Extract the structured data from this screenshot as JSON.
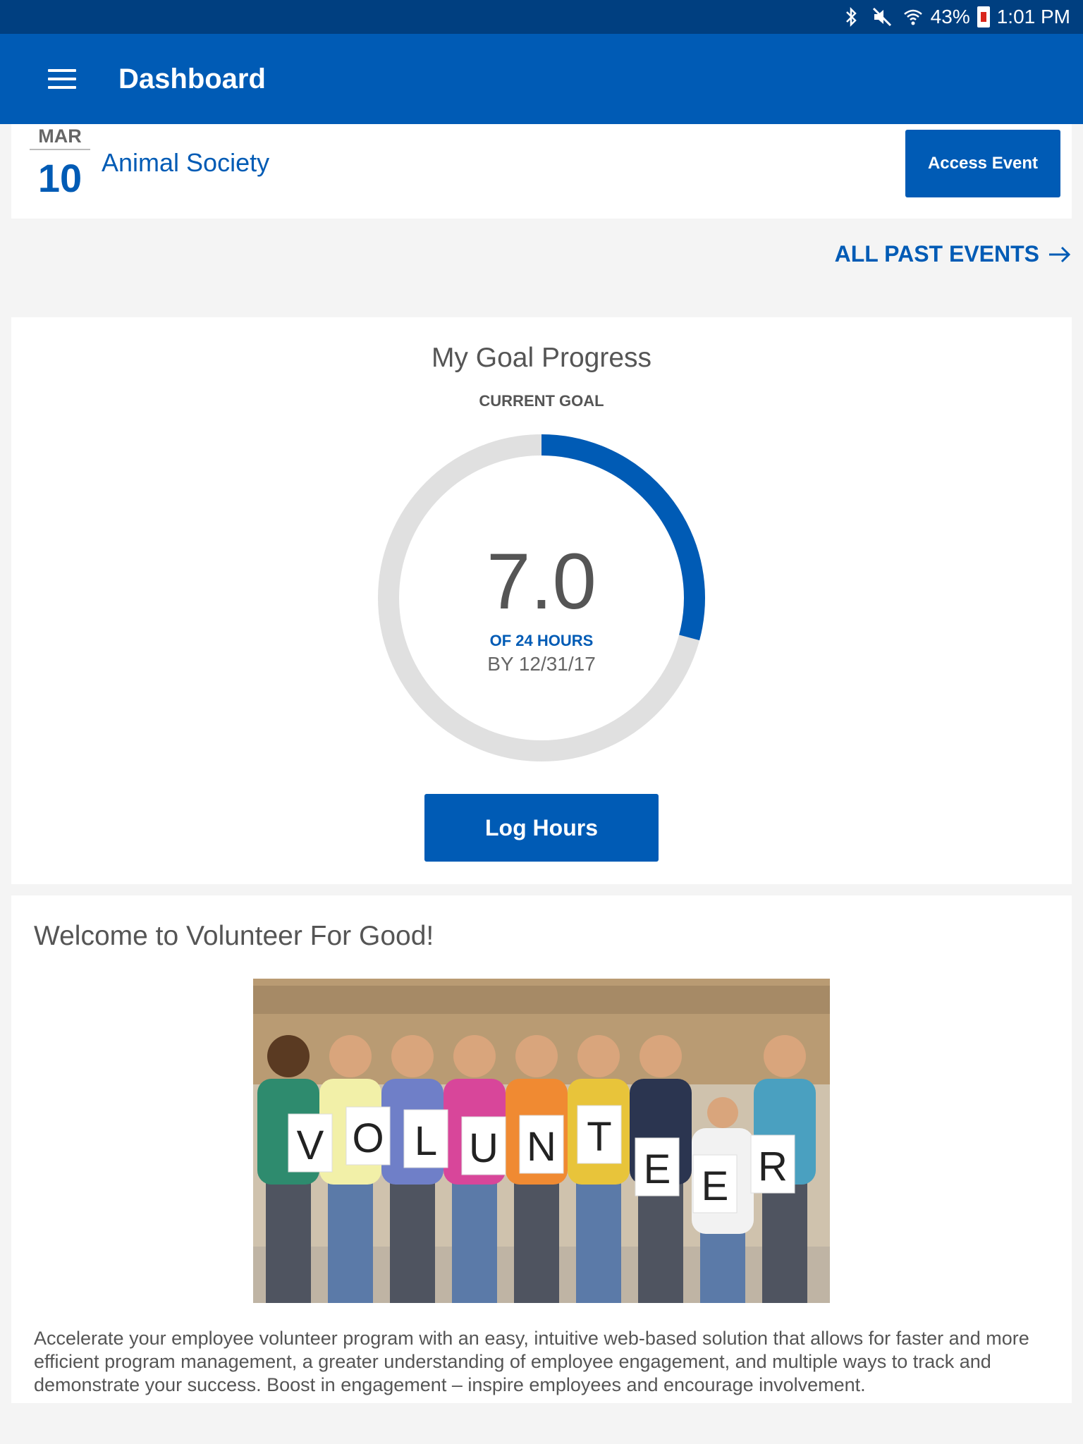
{
  "status_bar": {
    "battery_percent": "43%",
    "time": "1:01 PM",
    "icons": [
      "bluetooth-icon",
      "mute-icon",
      "wifi-icon",
      "battery-icon"
    ]
  },
  "app_bar": {
    "title": "Dashboard"
  },
  "event": {
    "month": "MAR",
    "day": "10",
    "name": "Animal Society",
    "access_label": "Access Event"
  },
  "past_events": {
    "label": "ALL PAST EVENTS"
  },
  "goal": {
    "title": "My Goal Progress",
    "subtitle": "CURRENT GOAL",
    "value": "7.0",
    "value_num": 7.0,
    "target_num": 24,
    "target_label": "OF 24 HOURS",
    "deadline": "BY 12/31/17",
    "log_label": "Log Hours"
  },
  "welcome": {
    "title": "Welcome to Volunteer For Good!",
    "photo_word": [
      "V",
      "O",
      "L",
      "U",
      "N",
      "T",
      "E",
      "E",
      "R"
    ],
    "body": "Accelerate your employee volunteer program with an easy, intuitive web-based solution that allows for faster and more efficient program management, a greater understanding of employee engagement, and multiple ways to track and demonstrate your success. Boost in engagement – inspire employees and encourage involvement."
  },
  "colors": {
    "primary": "#005bb5",
    "status_bar": "#003f80",
    "ring_track": "#e0e0e0",
    "background": "#f4f4f4"
  }
}
